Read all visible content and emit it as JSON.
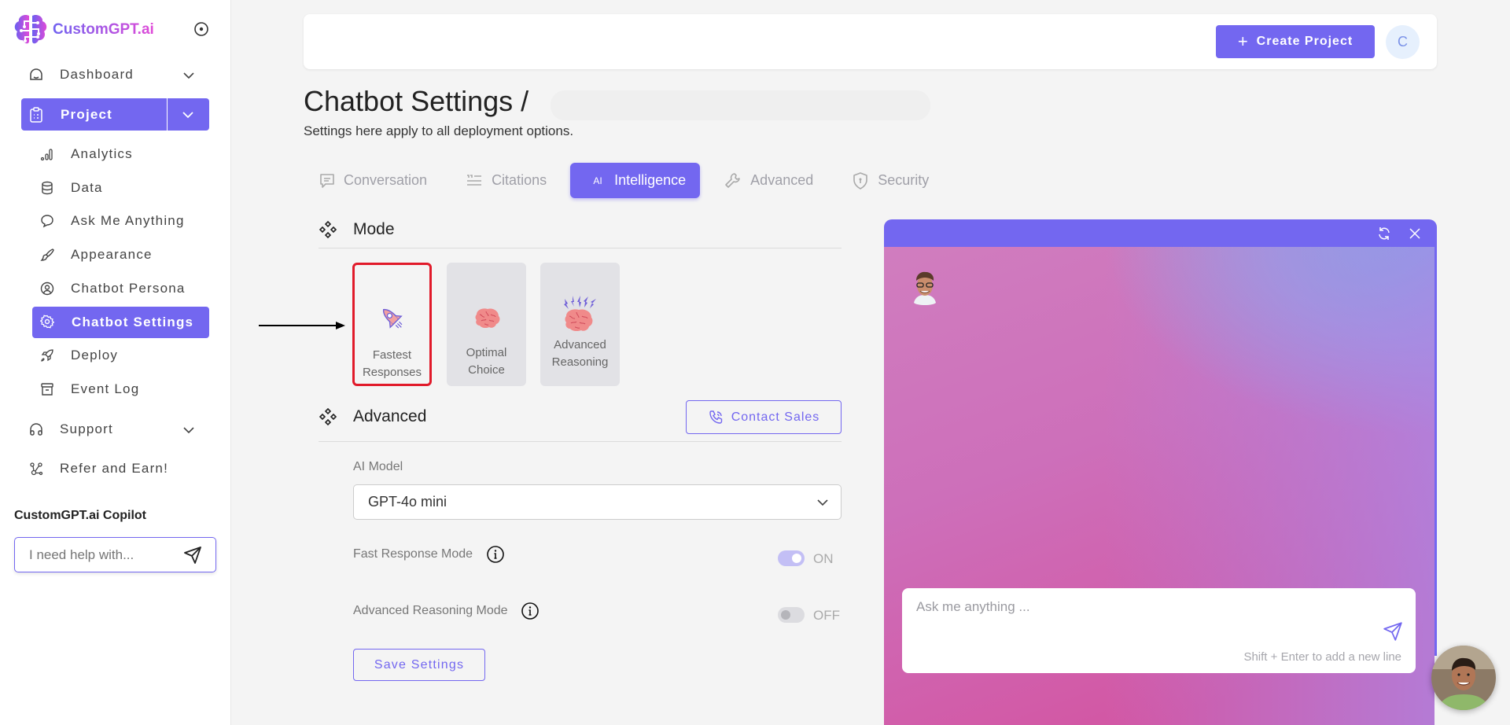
{
  "app": {
    "name": "CustomGPT.ai"
  },
  "sidebar": {
    "dashboard": "Dashboard",
    "project": "Project",
    "project_items": [
      {
        "label": "Analytics",
        "icon": "bar-chart-icon"
      },
      {
        "label": "Data",
        "icon": "database-icon"
      },
      {
        "label": "Ask Me Anything",
        "icon": "chat-bubble-icon"
      },
      {
        "label": "Appearance",
        "icon": "paintbrush-icon"
      },
      {
        "label": "Chatbot Persona",
        "icon": "user-circle-icon"
      },
      {
        "label": "Chatbot Settings",
        "icon": "gear-icon",
        "active": true
      },
      {
        "label": "Deploy",
        "icon": "rocket-icon"
      },
      {
        "label": "Event Log",
        "icon": "archive-icon"
      }
    ],
    "support": "Support",
    "refer": "Refer and Earn!",
    "copilot": {
      "title": "CustomGPT.ai Copilot",
      "placeholder": "I need help with..."
    }
  },
  "topbar": {
    "create_project": "Create Project",
    "avatar_initial": "C"
  },
  "page": {
    "title": "Chatbot Settings /",
    "subtitle": "Settings here apply to all deployment options."
  },
  "tabs": [
    {
      "label": "Conversation",
      "icon": "message-square-icon"
    },
    {
      "label": "Citations",
      "icon": "quote-list-icon"
    },
    {
      "label": "Intelligence",
      "icon": "ai-icon",
      "active": true,
      "icon_text": "AI"
    },
    {
      "label": "Advanced",
      "icon": "wrench-icon"
    },
    {
      "label": "Security",
      "icon": "shield-icon"
    }
  ],
  "mode": {
    "heading": "Mode",
    "options": [
      {
        "line1": "Fastest",
        "line2": "Responses",
        "selected": true
      },
      {
        "line1": "Optimal",
        "line2": "Choice",
        "selected": false
      },
      {
        "line1": "Advanced",
        "line2": "Reasoning",
        "selected": false
      }
    ]
  },
  "advanced": {
    "heading": "Advanced",
    "contact_sales": "Contact Sales",
    "ai_model_label": "AI Model",
    "ai_model_value": "GPT-4o mini",
    "fast_response": {
      "label": "Fast Response Mode",
      "state": "ON",
      "on": true
    },
    "advanced_reasoning": {
      "label": "Advanced Reasoning Mode",
      "state": "OFF",
      "on": false
    },
    "save": "Save Settings"
  },
  "chat_preview": {
    "placeholder": "Ask me anything ...",
    "hint": "Shift + Enter to add a new line"
  },
  "colors": {
    "accent": "#7367f0",
    "highlight": "#e11a2a"
  }
}
